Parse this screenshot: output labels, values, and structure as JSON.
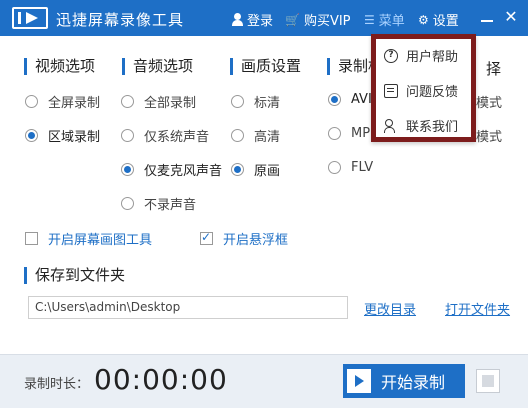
{
  "titlebar": {
    "title": "迅捷屏幕录像工具",
    "login": "登录",
    "buy_vip": "购买VIP",
    "menu": "菜单",
    "settings": "设置"
  },
  "sections": {
    "video": {
      "heading": "视频选项",
      "options": [
        "全屏录制",
        "区域录制"
      ],
      "selected": "区域录制"
    },
    "audio": {
      "heading": "音频选项",
      "options": [
        "全部录制",
        "仅系统声音",
        "仅麦克风声音",
        "不录声音"
      ],
      "selected": "仅麦克风声音"
    },
    "quality": {
      "heading": "画质设置",
      "options": [
        "标清",
        "高清",
        "原画"
      ],
      "selected": "原画"
    },
    "format": {
      "heading": "录制格",
      "options": [
        "AVI",
        "MP",
        "FLV"
      ],
      "selected": "AVI"
    },
    "mode": {
      "heading_tail": "择",
      "options": [
        "模式",
        "模式"
      ]
    }
  },
  "checkboxes": {
    "drawing_tool": {
      "label": "开启屏幕画图工具",
      "checked": false
    },
    "float_window": {
      "label": "开启悬浮框",
      "checked": true
    }
  },
  "save": {
    "heading": "保存到文件夹",
    "path": "C:\\Users\\admin\\Desktop",
    "change_dir": "更改目录",
    "open_folder": "打开文件夹"
  },
  "bottom": {
    "duration_label": "录制时长：",
    "duration_value": "00:00:00",
    "start_label": "开始录制"
  },
  "dropdown_menu": {
    "items": [
      {
        "label": "用户帮助",
        "icon": "help-icon"
      },
      {
        "label": "问题反馈",
        "icon": "feedback-icon"
      },
      {
        "label": "联系我们",
        "icon": "contact-icon"
      }
    ]
  },
  "colors": {
    "accent": "#1e6fc6",
    "menu_border": "#7d1c1c"
  }
}
